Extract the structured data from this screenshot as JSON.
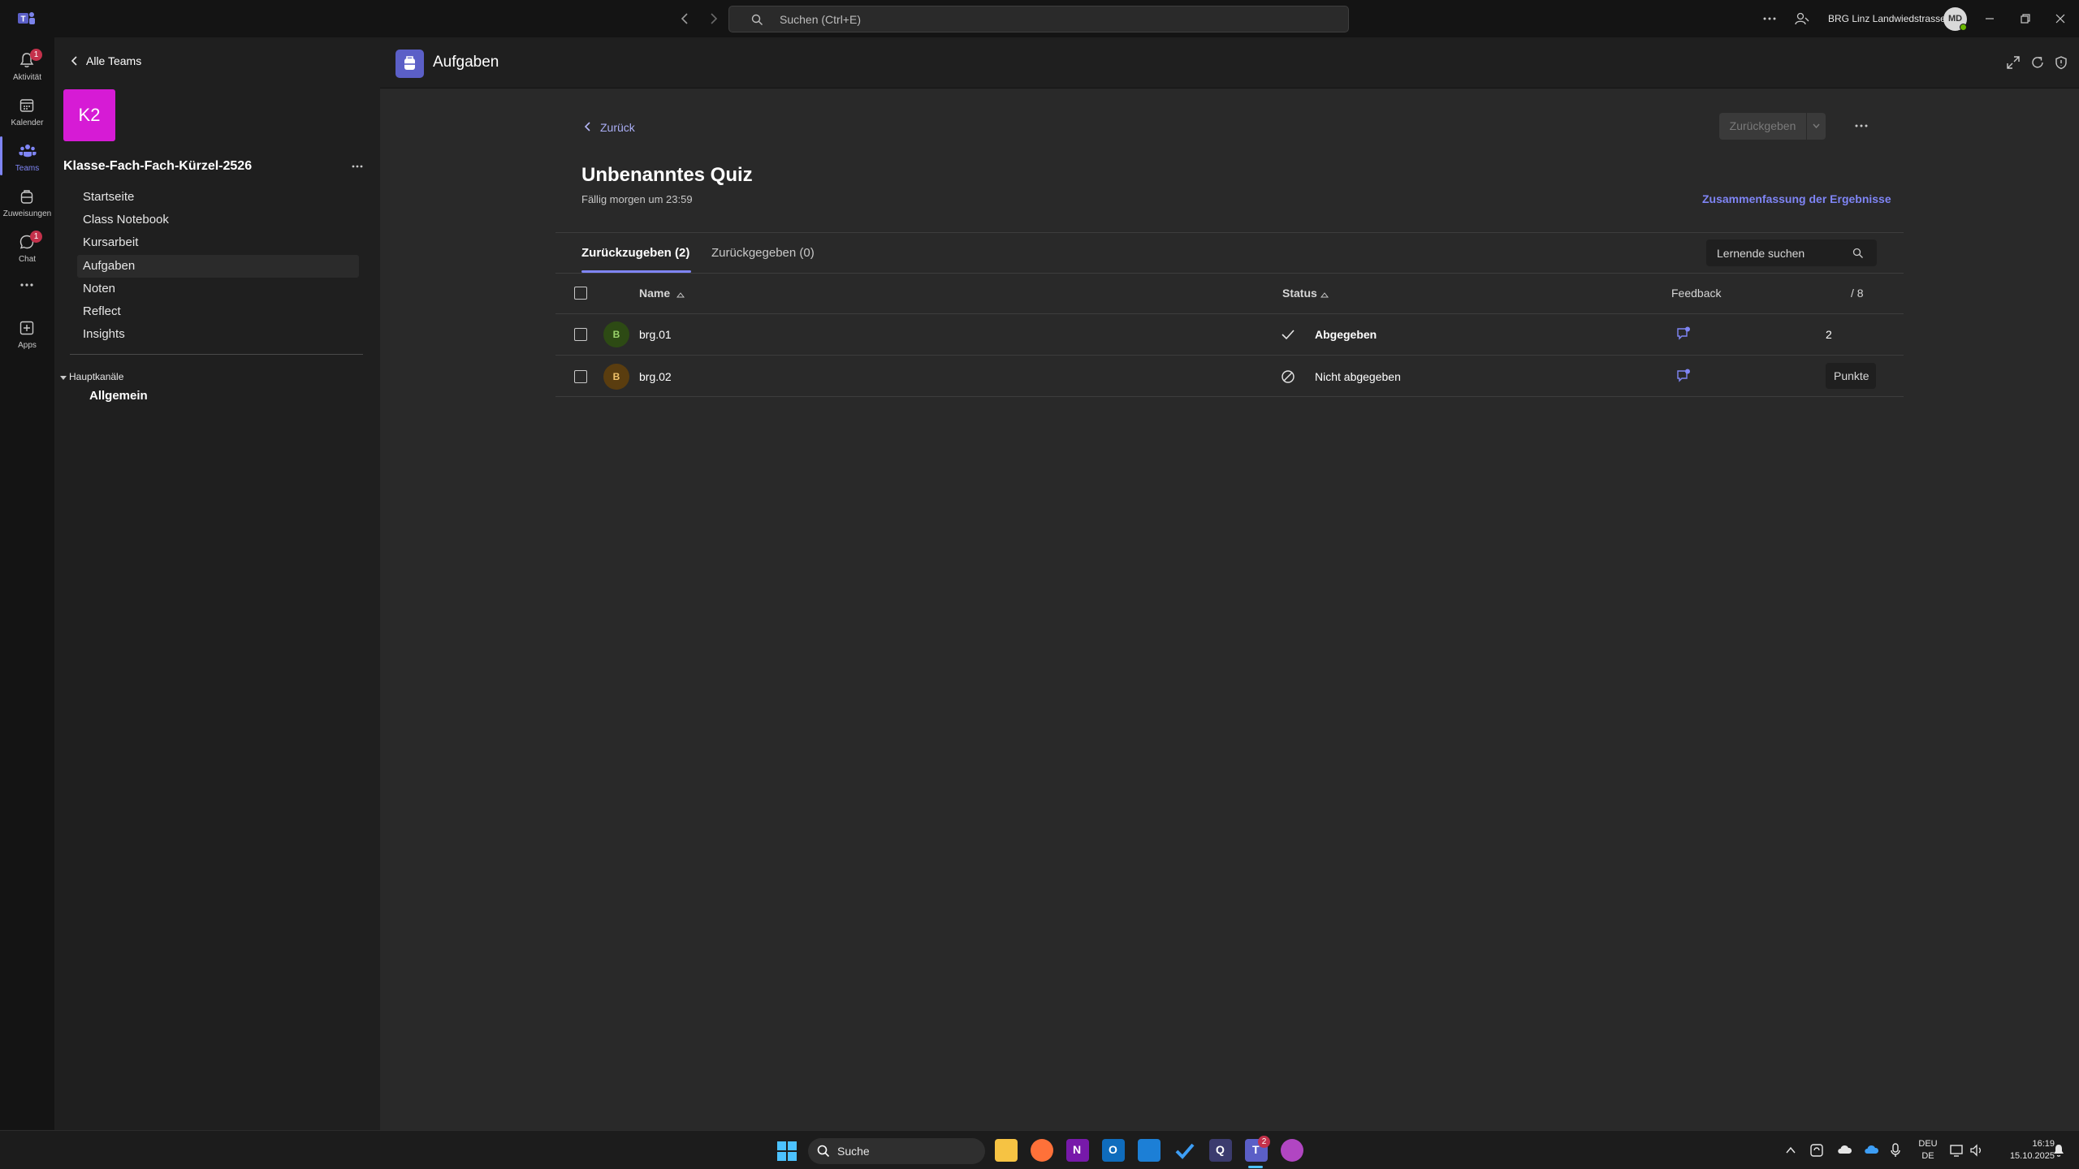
{
  "titlebar": {
    "search_placeholder": "Suchen (Ctrl+E)",
    "org_name": "BRG Linz Landwiedstrasse",
    "user_initials": "MD"
  },
  "rail": {
    "items": [
      {
        "label": "Aktivität",
        "icon": "bell-icon",
        "badge": "1"
      },
      {
        "label": "Kalender",
        "icon": "calendar-icon"
      },
      {
        "label": "Teams",
        "icon": "teams-icon"
      },
      {
        "label": "Zuweisungen",
        "icon": "backpack-icon"
      },
      {
        "label": "Chat",
        "icon": "chat-icon",
        "badge": "1"
      },
      {
        "label": "Apps",
        "icon": "apps-icon"
      }
    ]
  },
  "team": {
    "back_label": "Alle Teams",
    "avatar_text": "K2",
    "avatar_color": "#d61bd5",
    "name": "Klasse-Fach-Fach-Kürzel-2526",
    "nav": [
      "Startseite",
      "Class Notebook",
      "Kursarbeit",
      "Aufgaben",
      "Noten",
      "Reflect",
      "Insights"
    ],
    "channels_header": "Hauptkanäle",
    "channel": "Allgemein"
  },
  "app_header": {
    "title": "Aufgaben"
  },
  "assignment": {
    "back_label": "Zurück",
    "return_button": "Zurückgeben",
    "title": "Unbenanntes Quiz",
    "due": "Fällig morgen um 23:59",
    "summary_link": "Zusammenfassung der Ergebnisse",
    "tabs": [
      "Zurückzugeben (2)",
      "Zurückgegeben (0)"
    ],
    "search_placeholder": "Lernende suchen",
    "columns": {
      "name": "Name",
      "status": "Status",
      "feedback": "Feedback",
      "points": "/ 8"
    },
    "rows": [
      {
        "initial": "B",
        "name": "brg.01",
        "status": "Abgegeben",
        "points": "2",
        "avatar_bg": "#2d4a14",
        "avatar_fg": "#9bd46b"
      },
      {
        "initial": "B",
        "name": "brg.02",
        "status": "Nicht abgegeben",
        "points": "Punkte",
        "avatar_bg": "#5a3d0f",
        "avatar_fg": "#f0c36b"
      }
    ]
  },
  "taskbar": {
    "search_label": "Suche",
    "lang_top": "DEU",
    "lang_bottom": "DE",
    "time": "16:19",
    "date": "15.10.2025",
    "teams_badge": "2"
  },
  "colors": {
    "accent": "#7f85f5",
    "brand": "#5b5fc7"
  }
}
